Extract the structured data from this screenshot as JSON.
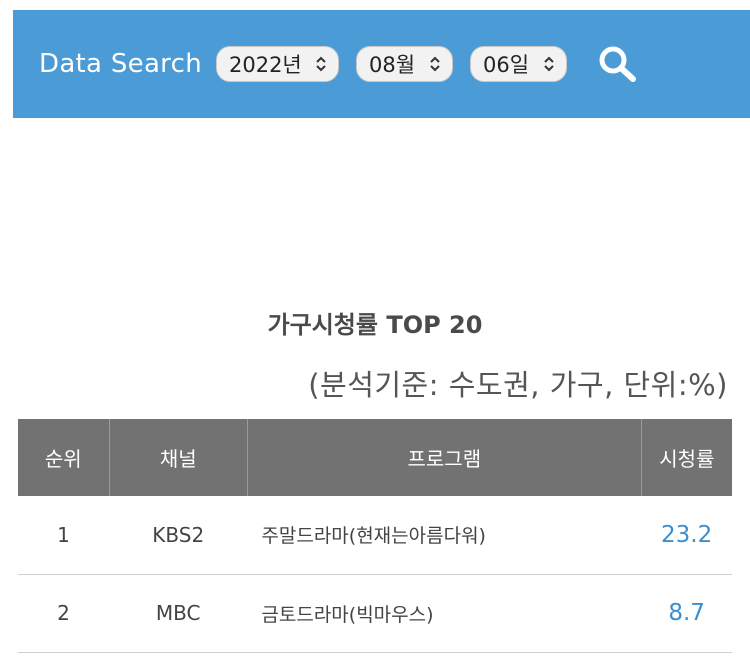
{
  "search": {
    "title": "Data Search",
    "year": "2022년",
    "month": "08월",
    "day": "06일",
    "icon": "search-icon"
  },
  "section": {
    "title": "가구시청률 TOP 20",
    "subtitle": "(분석기준: 수도권, 가구, 단위:%)"
  },
  "table": {
    "headers": [
      "순위",
      "채널",
      "프로그램",
      "시청률"
    ],
    "rows": [
      {
        "rank": "1",
        "channel": "KBS2",
        "program": "주말드라마(현재는아름다워)",
        "rating": "23.2"
      },
      {
        "rank": "2",
        "channel": "MBC",
        "program": "금토드라마(빅마우스)",
        "rating": "8.7"
      }
    ]
  },
  "colors": {
    "header_bar": "#4a9bd6",
    "table_header": "#727272",
    "rating_text": "#3b8fcf"
  }
}
